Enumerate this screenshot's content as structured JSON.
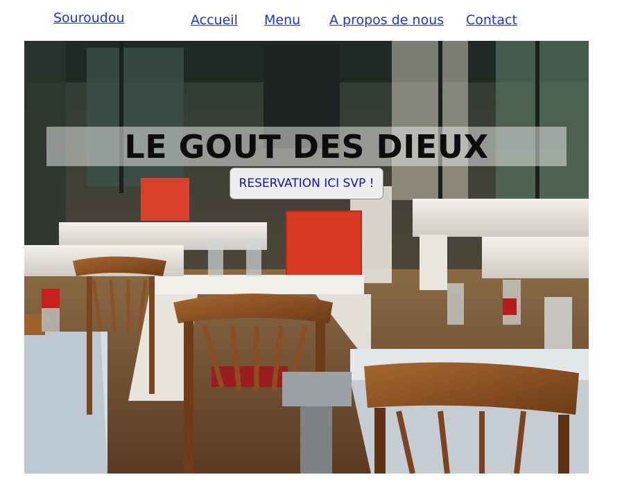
{
  "brand": {
    "label": "Souroudou"
  },
  "nav": {
    "items": [
      {
        "label": "Accueil"
      },
      {
        "label": "Menu"
      },
      {
        "label": "A propos de nous"
      },
      {
        "label": "Contact"
      }
    ]
  },
  "hero": {
    "title": "LE GOUT DES DIEUX",
    "cta_label": "RESERVATION ICI SVP !",
    "image_subject": "restaurant-terrace-photo"
  },
  "colors": {
    "link": "#1a33d6",
    "cta_text": "#1010c8",
    "title_text": "#0d0d0d"
  }
}
